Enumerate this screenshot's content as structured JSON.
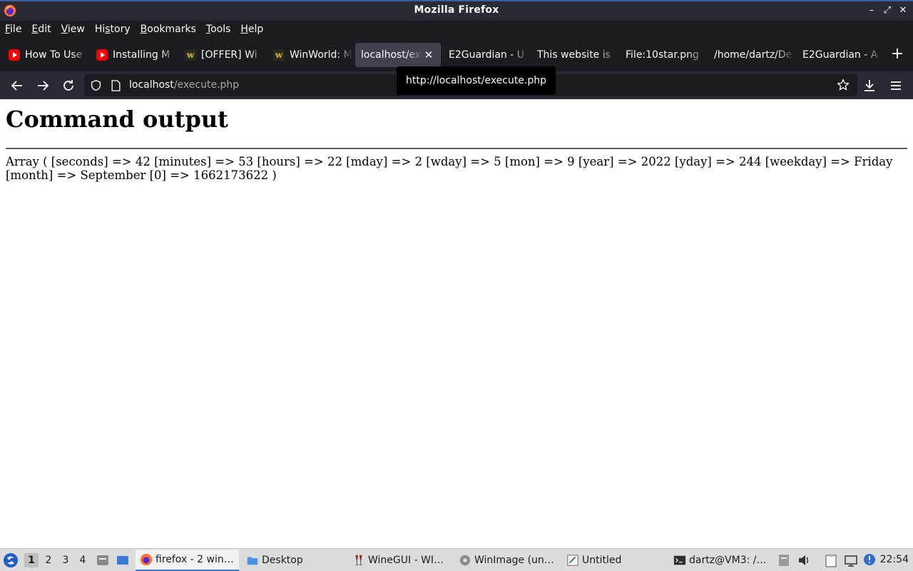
{
  "window": {
    "title": "Mozilla Firefox"
  },
  "menubar": {
    "items": [
      {
        "label": "File",
        "u": "F",
        "rest": "ile"
      },
      {
        "label": "Edit",
        "u": "E",
        "rest": "dit"
      },
      {
        "label": "View",
        "u": "V",
        "rest": "iew"
      },
      {
        "label": "History",
        "pre": "Hi",
        "u": "s",
        "rest": "tory"
      },
      {
        "label": "Bookmarks",
        "u": "B",
        "rest": "ookmarks"
      },
      {
        "label": "Tools",
        "u": "T",
        "rest": "ools"
      },
      {
        "label": "Help",
        "u": "H",
        "rest": "elp"
      }
    ]
  },
  "tabs": [
    {
      "label": "How To Use",
      "icon": "youtube-icon"
    },
    {
      "label": "Installing M",
      "icon": "youtube-icon"
    },
    {
      "label": "[OFFER] Wi",
      "icon": "winworld-icon"
    },
    {
      "label": "WinWorld: M",
      "icon": "winworld-icon"
    },
    {
      "label": "localhost/exe",
      "icon": "none",
      "active": true
    },
    {
      "label": "E2Guardian - U",
      "icon": "none"
    },
    {
      "label": "This website is",
      "icon": "none"
    },
    {
      "label": "File:10star.png",
      "icon": "none"
    },
    {
      "label": "/home/dartz/De",
      "icon": "none"
    },
    {
      "label": "E2Guardian - A",
      "icon": "none"
    }
  ],
  "navbar": {
    "url_host": "localhost",
    "url_path": "/execute.php"
  },
  "tooltip": {
    "text": "http://localhost/execute.php"
  },
  "page": {
    "heading": "Command output",
    "output": "Array ( [seconds] => 42 [minutes] => 53 [hours] => 22 [mday] => 2 [wday] => 5 [mon] => 9 [year] => 2022 [yday] => 244 [weekday] => Friday [month] => September [0] => 1662173622 )"
  },
  "taskbar": {
    "workspaces": [
      "1",
      "2",
      "3",
      "4"
    ],
    "tasks": [
      {
        "label": "firefox - 2 win…",
        "icon": "firefox-icon",
        "active": true
      },
      {
        "label": "Desktop",
        "icon": "folder-icon"
      },
      {
        "label": "WineGUI - WI…",
        "icon": "wine-icon"
      },
      {
        "label": "WinImage (un…",
        "icon": "winimage-icon"
      },
      {
        "label": "Untitled",
        "icon": "text-editor-icon"
      },
      {
        "label": "dartz@VM3: /…",
        "icon": "terminal-icon"
      }
    ],
    "clock": "22:54"
  }
}
